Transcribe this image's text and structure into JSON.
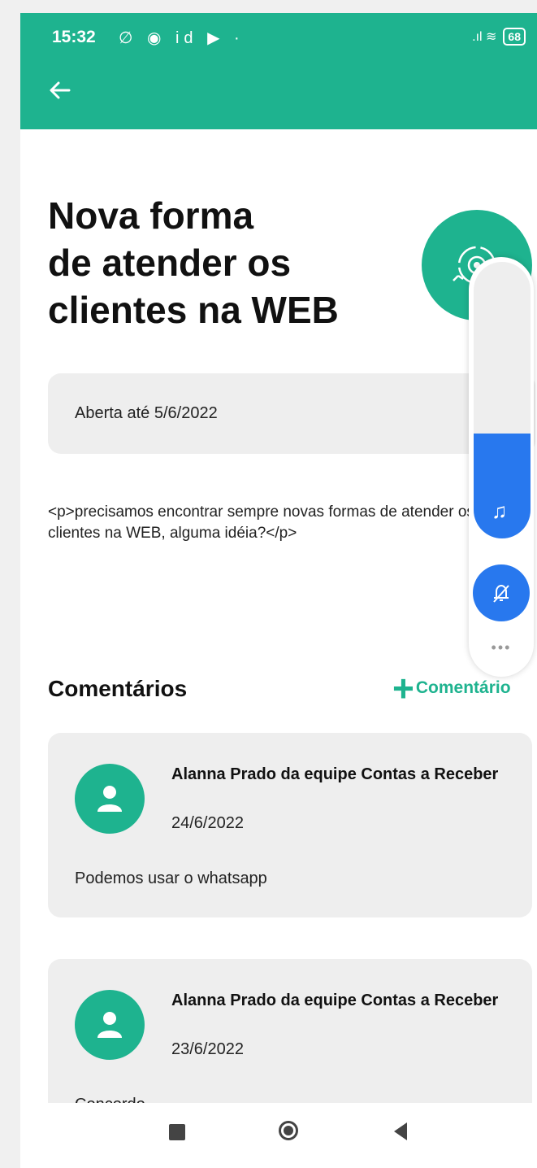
{
  "status_bar": {
    "time": "15:32",
    "left_icons": "∅ ◉ id ▶ ·",
    "right_icons": ".ıl ≋",
    "battery": "68"
  },
  "page": {
    "title": "Nova forma\nde atender os\nclientes na WEB",
    "deadline": "Aberta até 5/6/2022",
    "description": "<p>precisamos encontrar sempre novas formas de atender os clientes na WEB, alguma idéia?</p>"
  },
  "comments": {
    "title": "Comentários",
    "add_plus": "+",
    "add_label": "Comentário",
    "items": [
      {
        "author": "Alanna Prado da equipe Contas a Receber",
        "date": "24/6/2022",
        "text": "Podemos usar o whatsapp"
      },
      {
        "author": "Alanna Prado da equipe Contas a Receber",
        "date": "23/6/2022",
        "text": "Concordo"
      }
    ]
  },
  "volume_panel": {
    "music_icon": "♫",
    "more": "•••",
    "level": 0.38
  },
  "colors": {
    "primary": "#1eb38f",
    "accent_blue": "#2878ee",
    "card_bg": "#eeeeee"
  }
}
